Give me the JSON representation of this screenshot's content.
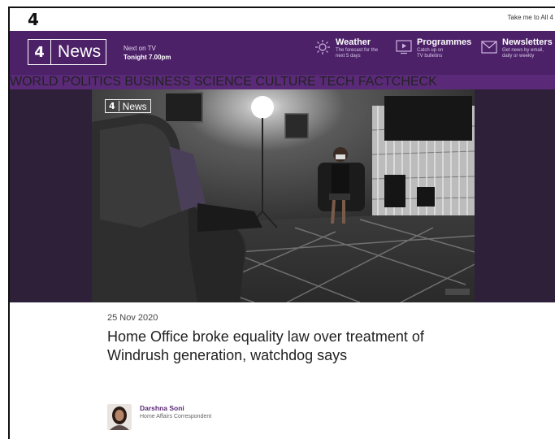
{
  "topbar": {
    "logo": "4",
    "all4_link": "Take me to All 4"
  },
  "header": {
    "brand_number": "4",
    "brand_name": "News",
    "next_on_tv": {
      "label": "Next on TV",
      "time": "Tonight 7.00pm"
    },
    "weather": {
      "title": "Weather",
      "subtitle_line1": "The forecast for the",
      "subtitle_line2": "next 5 days"
    },
    "programmes": {
      "title": "Programmes",
      "subtitle_line1": "Catch up on",
      "subtitle_line2": "TV bulletins"
    },
    "newsletters": {
      "title": "Newsletters",
      "subtitle_line1": "Get news by email,",
      "subtitle_line2": "daily or weekly"
    }
  },
  "nav": {
    "items": [
      "WORLD",
      "POLITICS",
      "BUSINESS",
      "SCIENCE",
      "CULTURE",
      "TECH",
      "FACTCHECK"
    ]
  },
  "hero": {
    "watermark_number": "4",
    "watermark_name": "News"
  },
  "article": {
    "date": "25 Nov 2020",
    "headline": "Home Office broke equality law over treatment of Windrush generation, watchdog says",
    "author_name": "Darshna Soni",
    "author_role": "Home Affairs Correspondent"
  },
  "colors": {
    "header_purple": "#4c2168",
    "nav_purple": "#5a2a78",
    "hero_bg": "#2d2038"
  }
}
